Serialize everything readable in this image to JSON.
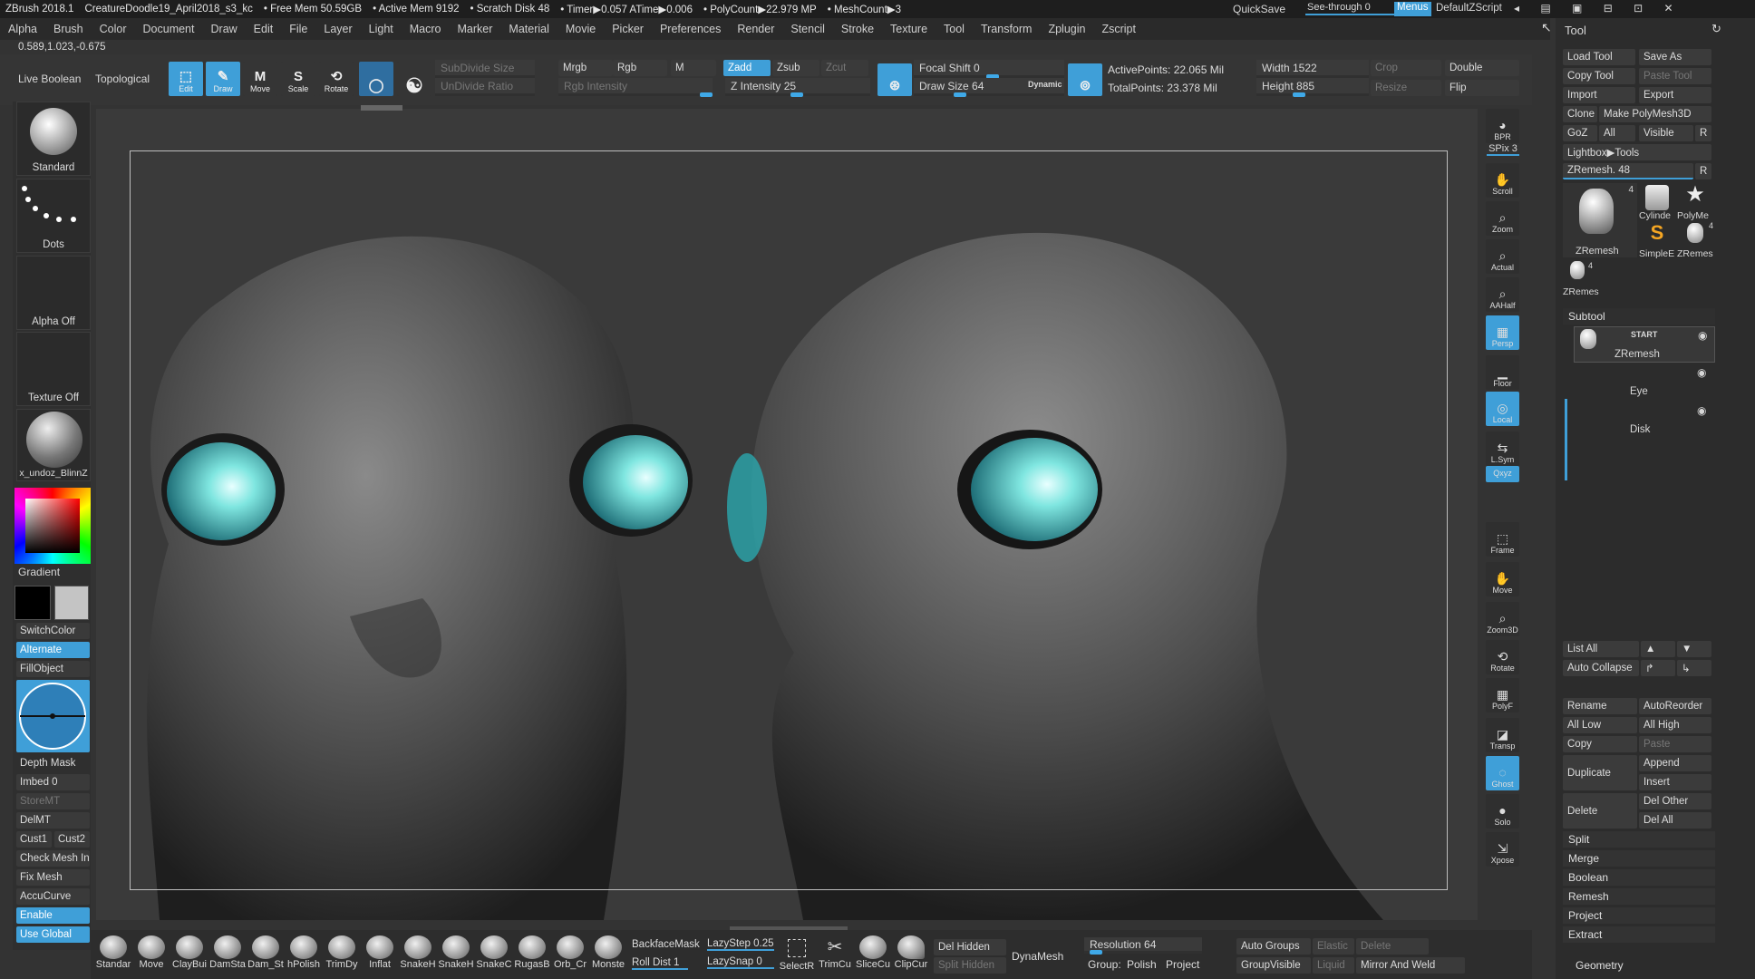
{
  "titlebar": {
    "app": "ZBrush 2018.1",
    "document": "CreatureDoodle19_April2018_s3_kc",
    "free_mem": "• Free Mem 50.59GB",
    "active_mem": "• Active Mem 9192",
    "scratch": "• Scratch Disk 48",
    "timer": "• Timer▶0.057 ATime▶0.006",
    "polycount": "• PolyCount▶22.979 MP",
    "meshcount": "• MeshCount▶3",
    "quicksave": "QuickSave",
    "seethrough": "See-through  0",
    "menus": "Menus",
    "script": "DefaultZScript"
  },
  "menubar": [
    "Alpha",
    "Brush",
    "Color",
    "Document",
    "Draw",
    "Edit",
    "File",
    "Layer",
    "Light",
    "Macro",
    "Marker",
    "Material",
    "Movie",
    "Picker",
    "Preferences",
    "Render",
    "Stencil",
    "Stroke",
    "Texture",
    "Tool",
    "Transform",
    "Zplugin",
    "Zscript"
  ],
  "coords": "0.589,1.023,-0.675",
  "topbar": {
    "live_boolean": "Live Boolean",
    "topological": "Topological",
    "edit": "Edit",
    "draw": "Draw",
    "move": "Move",
    "scale": "Scale",
    "rotate": "Rotate",
    "subdivide_size": "SubDivide Size",
    "undivide_ratio": "UnDivide Ratio",
    "mrgb": "Mrgb",
    "rgb": "Rgb",
    "m": "M",
    "rgb_intensity": "Rgb Intensity",
    "zadd": "Zadd",
    "zsub": "Zsub",
    "zcut": "Zcut",
    "z_intensity": "Z Intensity 25",
    "focal_shift": "Focal Shift 0",
    "draw_size": "Draw Size 64",
    "dynamic": "Dynamic",
    "active_points": "ActivePoints: 22.065 Mil",
    "total_points": "TotalPoints: 23.378 Mil",
    "width": "Width 1522",
    "height": "Height 885",
    "crop": "Crop",
    "resize": "Resize",
    "double": "Double",
    "flip": "Flip"
  },
  "leftshelf": {
    "brush": "Standard",
    "stroke": "Dots",
    "alpha": "Alpha Off",
    "texture": "Texture Off",
    "material": "x_undoz_BlinnZ",
    "gradient": "Gradient",
    "switchcolor": "SwitchColor",
    "alternate": "Alternate",
    "fillobject": "FillObject",
    "depth_mask": "Depth Mask",
    "imbed": "Imbed 0",
    "storemt": "StoreMT",
    "delmt": "DelMT",
    "cust1": "Cust1",
    "cust2": "Cust2",
    "check_mesh": "Check Mesh In",
    "fix_mesh": "Fix Mesh",
    "accucurve": "AccuCurve",
    "enable": "Enable",
    "use_global": "Use Global",
    "colors": {
      "main": "#000000",
      "secondary": "#c4c4c4",
      "accent": "#3f9fd8"
    }
  },
  "rightshelf": [
    "BPR",
    "SPix 3",
    "Scroll",
    "Zoom",
    "Actual",
    "AAHalf",
    "Persp",
    "Floor",
    "Local",
    "L.Sym",
    "Qxyz",
    "Frame",
    "Move",
    "Zoom3D",
    "Rotate",
    "PolyF",
    "Transp",
    "Ghost",
    "Solo",
    "Xpose"
  ],
  "toolpanel": {
    "title": "Tool",
    "load_tool": "Load Tool",
    "save_as": "Save As",
    "copy_tool": "Copy Tool",
    "paste_tool": "Paste Tool",
    "import": "Import",
    "export": "Export",
    "clone": "Clone",
    "make_polymesh": "Make PolyMesh3D",
    "goz": "GoZ",
    "all": "All",
    "visible": "Visible",
    "r": "R",
    "lightbox": "Lightbox▶Tools",
    "zremesh": "ZRemesh. 48",
    "tools": [
      {
        "name": "ZRemesh",
        "count": "4"
      },
      {
        "name": "Cylinde",
        "count": ""
      },
      {
        "name": "PolyMe",
        "count": ""
      },
      {
        "name": "SimpleE",
        "count": ""
      },
      {
        "name": "ZRemes",
        "count": "4"
      },
      {
        "name": "ZRemes",
        "count": "4"
      }
    ],
    "subtool_header": "Subtool",
    "subtools": [
      {
        "name": "ZRemesh",
        "badge": "START"
      },
      {
        "name": "Eye",
        "badge": ""
      },
      {
        "name": "Disk",
        "badge": ""
      }
    ],
    "list_all": "List All",
    "auto_collapse": "Auto Collapse",
    "rename": "Rename",
    "autoreorder": "AutoReorder",
    "all_low": "All Low",
    "all_high": "All High",
    "copy": "Copy",
    "paste": "Paste",
    "duplicate": "Duplicate",
    "append": "Append",
    "insert": "Insert",
    "delete": "Delete",
    "del_other": "Del Other",
    "del_all": "Del All",
    "split": "Split",
    "merge": "Merge",
    "boolean": "Boolean",
    "remesh": "Remesh",
    "project": "Project",
    "extract": "Extract",
    "geometry": "Geometry"
  },
  "bottombar": {
    "brushes": [
      "Standar",
      "Move",
      "ClayBui",
      "DamSta",
      "Dam_St",
      "hPolish",
      "TrimDy",
      "Inflat",
      "SnakeH",
      "SnakeH",
      "SnakeC",
      "RugasB",
      "Orb_Cr",
      "Monste"
    ],
    "backface": "BackfaceMask",
    "roll_dist": "Roll Dist 1",
    "lazystep": "LazyStep 0.25",
    "lazysnap": "LazySnap 0",
    "selectr": "SelectR",
    "trimcu": "TrimCu",
    "slicecu": "SliceCu",
    "clipcur": "ClipCur",
    "del_hidden": "Del Hidden",
    "split_hidden": "Split Hidden",
    "dynamesh": "DynaMesh",
    "resolution": "Resolution 64",
    "group": "Group:",
    "polish": "Polish",
    "project": "Project",
    "auto_groups": "Auto Groups",
    "elastic": "Elastic",
    "delete": "Delete",
    "groupvisible": "GroupVisible",
    "liquid": "Liquid",
    "mirror_weld": "Mirror And Weld"
  }
}
